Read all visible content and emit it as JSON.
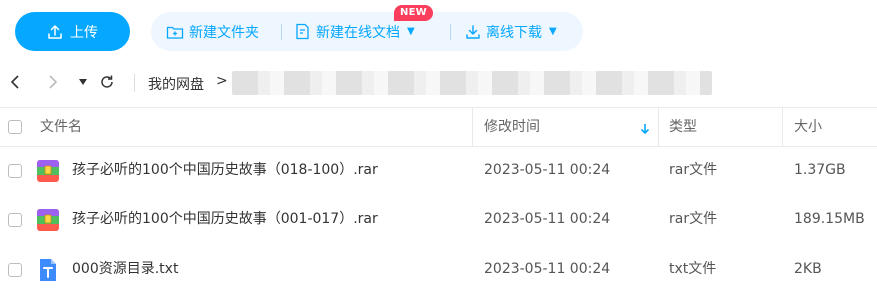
{
  "toolbar": {
    "upload_label": "上传",
    "new_folder_label": "新建文件夹",
    "new_online_doc_label": "新建在线文档",
    "new_badge": "NEW",
    "offline_download_label": "离线下载",
    "accent_color": "#06a7ff",
    "badge_color": "#fa3e5c"
  },
  "nav": {
    "breadcrumb_root": "我的网盘",
    "breadcrumb_sep": ">"
  },
  "table": {
    "headers": {
      "name": "文件名",
      "modified": "修改时间",
      "type": "类型",
      "size": "大小"
    },
    "sort_column": "modified",
    "rows": [
      {
        "icon": "rar-archive-icon",
        "name": "孩子必听的100个中国历史故事（018-100）.rar",
        "modified": "2023-05-11 00:24",
        "type": "rar文件",
        "size": "1.37GB"
      },
      {
        "icon": "rar-archive-icon",
        "name": "孩子必听的100个中国历史故事（001-017）.rar",
        "modified": "2023-05-11 00:24",
        "type": "rar文件",
        "size": "189.15MB"
      },
      {
        "icon": "txt-file-icon",
        "name": "000资源目录.txt",
        "modified": "2023-05-11 00:24",
        "type": "txt文件",
        "size": "2KB"
      }
    ]
  }
}
